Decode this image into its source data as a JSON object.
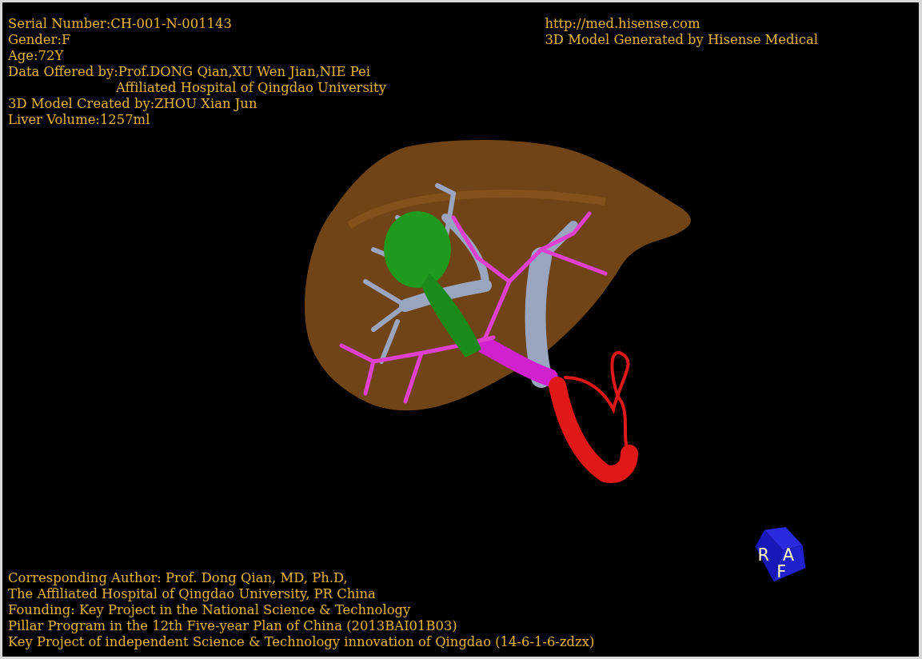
{
  "patient_info": [
    {
      "text": "Serial Number:CH-001-N-001143",
      "indented": false
    },
    {
      "text": "Gender:F",
      "indented": false
    },
    {
      "text": "Age:72Y",
      "indented": false
    },
    {
      "text": "Data Offered by:Prof.DONG Qian,XU Wen Jian,NIE Pei",
      "indented": false
    },
    {
      "text": "Affiliated Hospital of Qingdao University",
      "indented": true
    },
    {
      "text": "3D Model Created by:ZHOU Xian Jun",
      "indented": false
    },
    {
      "text": "Liver Volume:1257ml",
      "indented": false
    }
  ],
  "vendor_info": [
    "http://med.hisense.com",
    "3D Model Generated by Hisense Medical"
  ],
  "credits": [
    "Corresponding Author: Prof. Dong Qian, MD, Ph.D,",
    "The Affiliated Hospital of Qingdao University, PR China",
    "Founding: Key Project in the National Science & Technology",
    "Pillar Program in the 12th Five-year Plan of China (2013BAI01B03)",
    "Key Project of independent Science & Technology innovation of Qingdao (14-6-1-6-zdzx)"
  ],
  "orientation_cube": {
    "faces": [
      "R",
      "A",
      "F"
    ]
  }
}
